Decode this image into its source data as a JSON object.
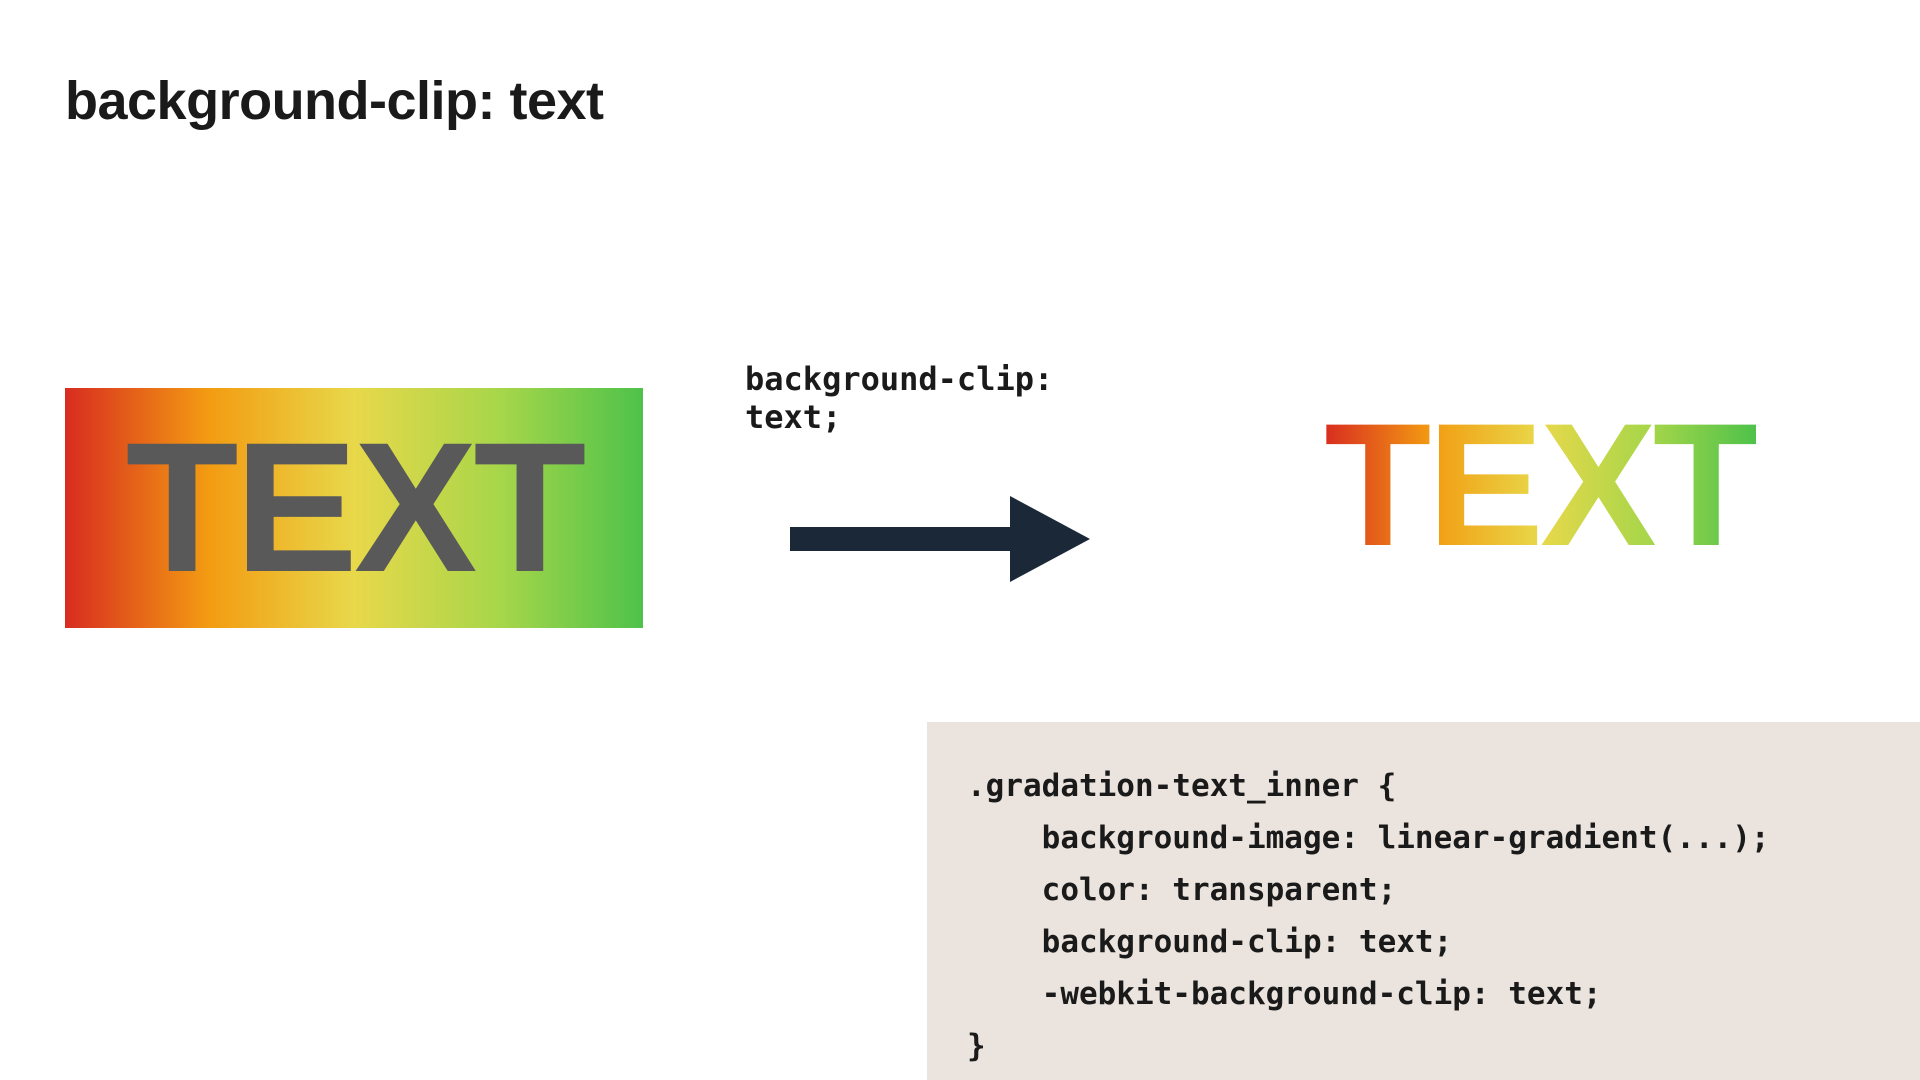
{
  "title": "background-clip: text",
  "demo": {
    "before_text": "TEXT",
    "after_text": "TEXT",
    "arrow_label": "background-clip: text;"
  },
  "code": ".gradation-text_inner {\n    background-image: linear-gradient(...);\n    color: transparent;\n    background-clip: text;\n    -webkit-background-clip: text;\n}",
  "colors": {
    "gradient_start": "#d82c20",
    "gradient_end": "#4ec24a",
    "text_gray": "#595959",
    "arrow_color": "#1a2838",
    "code_bg": "#ebe4de"
  }
}
